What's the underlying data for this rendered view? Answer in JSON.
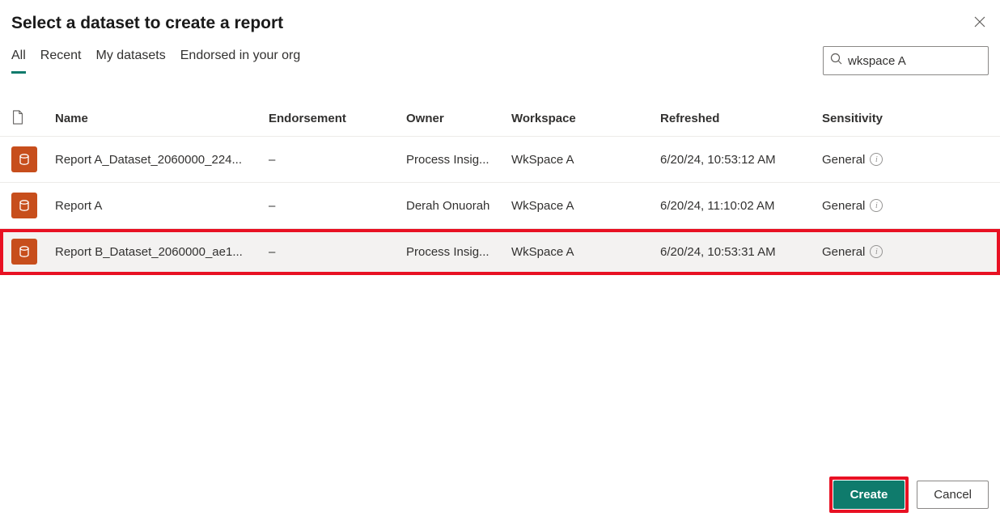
{
  "dialog": {
    "title": "Select a dataset to create a report"
  },
  "tabs": {
    "all": "All",
    "recent": "Recent",
    "my_datasets": "My datasets",
    "endorsed": "Endorsed in your org"
  },
  "search": {
    "value": "wkspace A"
  },
  "columns": {
    "name": "Name",
    "endorsement": "Endorsement",
    "owner": "Owner",
    "workspace": "Workspace",
    "refreshed": "Refreshed",
    "sensitivity": "Sensitivity"
  },
  "rows": [
    {
      "name": "Report A_Dataset_2060000_224...",
      "endorsement": "–",
      "owner": "Process Insig...",
      "workspace": "WkSpace A",
      "refreshed": "6/20/24, 10:53:12 AM",
      "sensitivity": "General"
    },
    {
      "name": "Report A",
      "endorsement": "–",
      "owner": "Derah Onuorah",
      "workspace": "WkSpace A",
      "refreshed": "6/20/24, 11:10:02 AM",
      "sensitivity": "General"
    },
    {
      "name": "Report B_Dataset_2060000_ae1...",
      "endorsement": "–",
      "owner": "Process Insig...",
      "workspace": "WkSpace A",
      "refreshed": "6/20/24, 10:53:31 AM",
      "sensitivity": "General"
    }
  ],
  "buttons": {
    "create": "Create",
    "cancel": "Cancel"
  }
}
